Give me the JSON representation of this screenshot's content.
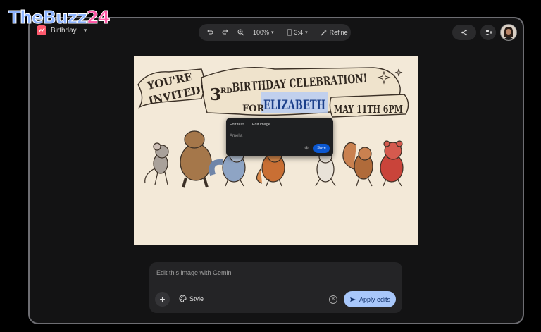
{
  "watermark": {
    "part1": "TheBuzz",
    "part2": "24"
  },
  "document": {
    "title": "Birthday"
  },
  "toolbar": {
    "zoom": "100%",
    "aspect_ratio": "3:4",
    "refine_label": "Refine"
  },
  "invitation": {
    "line1": "YOU'RE",
    "line2": "INVITED!",
    "headline_prefix": "3",
    "headline_suffix": "RD",
    "headline_rest": "BIRTHDAY CELEBRATION!",
    "for_label": "FOR",
    "name": "ELIZABETH",
    "date": "MAY 11TH 6PM"
  },
  "edit_popup": {
    "tabs": [
      "Edit text",
      "Edit image"
    ],
    "active_tab": "Edit text",
    "input_value": "Amelia",
    "save_label": "Save"
  },
  "prompt": {
    "placeholder": "Edit this image with Gemini",
    "style_label": "Style",
    "apply_label": "Apply edits"
  },
  "colors": {
    "accent": "#a8c7fa",
    "save_button": "#0b57d0",
    "paper": "#f3e9d8",
    "highlight": "#b9ccf2"
  }
}
